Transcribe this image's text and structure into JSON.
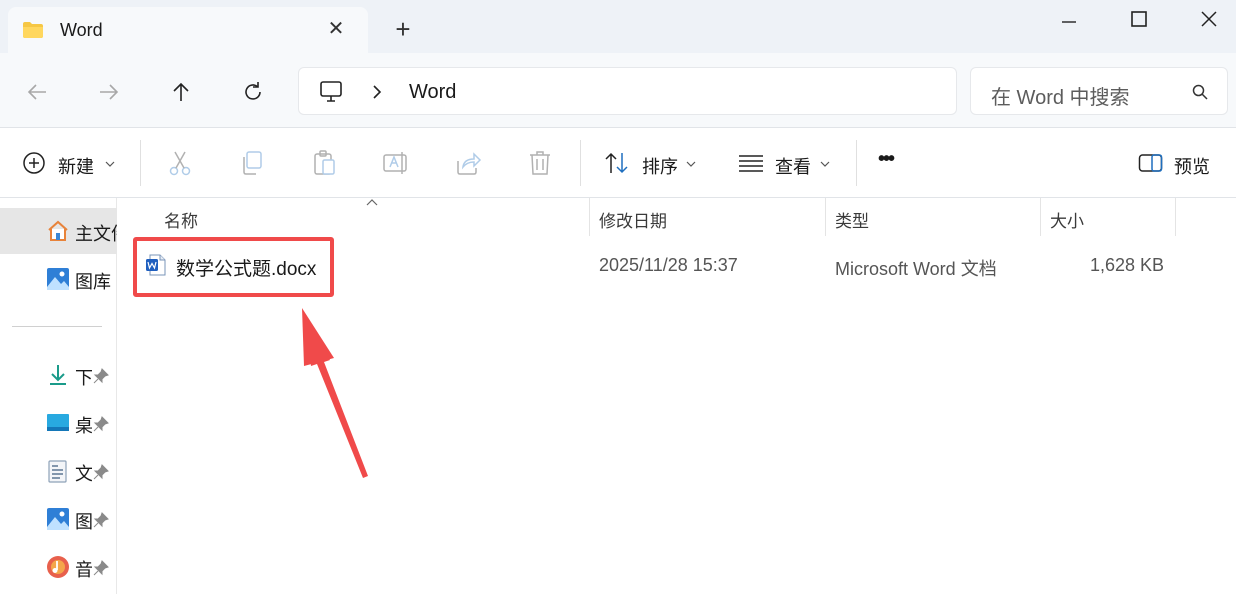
{
  "window": {
    "tab_title": "Word",
    "tab_close": "✕",
    "new_tab": "+"
  },
  "navigation": {
    "breadcrumb": [
      "Word"
    ],
    "search_placeholder": "在 Word 中搜索"
  },
  "command_bar": {
    "new_label": "新建",
    "sort_label": "排序",
    "view_label": "查看",
    "more_label": "•••",
    "preview_label": "预览"
  },
  "sidebar": {
    "items": [
      {
        "label": "主文件夹",
        "icon": "home-icon",
        "pinned": false,
        "selected": true
      },
      {
        "label": "图库",
        "icon": "gallery-icon",
        "pinned": false,
        "selected": false
      },
      {
        "label": "下载",
        "icon": "download-icon",
        "pinned": true,
        "selected": false
      },
      {
        "label": "桌面",
        "icon": "desktop-icon",
        "pinned": true,
        "selected": false
      },
      {
        "label": "文档",
        "icon": "documents-icon",
        "pinned": true,
        "selected": false
      },
      {
        "label": "图片",
        "icon": "pictures-icon",
        "pinned": true,
        "selected": false
      },
      {
        "label": "音乐",
        "icon": "music-icon",
        "pinned": true,
        "selected": false
      }
    ]
  },
  "file_list": {
    "columns": [
      "名称",
      "修改日期",
      "类型",
      "大小"
    ],
    "rows": [
      {
        "name": "数学公式题.docx",
        "modified": "2025/11/28 15:37",
        "type": "Microsoft Word 文档",
        "size": "1,628 KB"
      }
    ]
  },
  "colors": {
    "highlight": "#f04a4a",
    "accent": "#0067c0"
  }
}
